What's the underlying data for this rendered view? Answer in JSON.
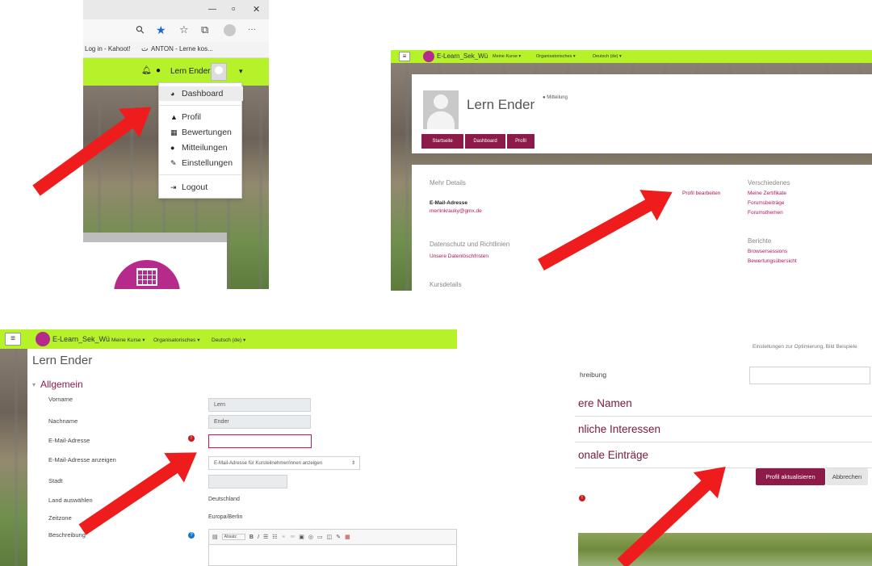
{
  "panel1": {
    "window_controls": {
      "minimize": "—",
      "maximize": "▫",
      "close": "✕"
    },
    "toolbar_icons": {
      "search": "⚲",
      "star": "★",
      "favorites": "☆",
      "collections": "⧉",
      "more": "···"
    },
    "bookmarks": {
      "kahoot": "Log in - Kahoot!",
      "anton": "ANTON - Lerne kos..."
    },
    "nav": {
      "user_name": "Lern Ender",
      "caret": "▾"
    },
    "menu": {
      "dashboard": "Dashboard",
      "profil": "Profil",
      "bewertungen": "Bewertungen",
      "mitteilungen": "Mitteilungen",
      "einstellungen": "Einstellungen",
      "logout": "Logout"
    }
  },
  "panel2": {
    "brand": "E-Learn_Sek_Wü",
    "nav": {
      "kurse": "Meine Kurse ▾",
      "orga": "Organisatorisches ▾",
      "lang": "Deutsch (de) ▾"
    },
    "user_name": "Lern Ender",
    "message_link": "Mitteilung",
    "breadcrumbs": {
      "startseite": "Startseite",
      "dashboard": "Dashboard",
      "profil": "Profil"
    },
    "details": {
      "heading": "Mehr Details",
      "edit_link": "Profil bearbeiten",
      "email_label": "E-Mail-Adresse",
      "email_value": "merlinkrauky@gmx.de",
      "privacy_heading": "Datenschutz und Richtlinien",
      "privacy_link": "Unsere Datenlöschfristen",
      "course_heading": "Kursdetails"
    },
    "misc": {
      "heading": "Verschiedenes",
      "certificates": "Meine Zertifikate",
      "forum_posts": "Forumsbeiträge",
      "forum_topics": "Forumsthemen"
    },
    "reports": {
      "heading": "Berichte",
      "sessions": "Browsersessions",
      "grades": "Bewertungsübersicht"
    }
  },
  "panel3": {
    "brand": "E-Learn_Sek_Wü",
    "nav": {
      "kurse": "Meine Kurse ▾",
      "orga": "Organisatorisches ▾",
      "lang": "Deutsch (de) ▾"
    },
    "page_title": "Lern Ender",
    "section": "Allgemein",
    "labels": {
      "vorname": "Vorname",
      "nachname": "Nachname",
      "email": "E-Mail-Adresse",
      "email_show": "E-Mail-Adresse anzeigen",
      "stadt": "Stadt",
      "land": "Land auswählen",
      "zeitzone": "Zeitzone",
      "beschreibung": "Beschreibung"
    },
    "values": {
      "vorname": "Lern",
      "nachname": "Ender",
      "email": "",
      "email_show": "E-Mail-Adresse für Kursteilnehmer/innen anzeigen",
      "stadt": "",
      "land": "Deutschland",
      "zeitzone": "Europa/Berlin"
    },
    "editor": {
      "format": "Absatz",
      "bold": "B",
      "italic": "I"
    }
  },
  "panel4": {
    "top_text": "Einstellungen zur Optimierung, Bild Beispiele",
    "beschreibung_label": "hreibung",
    "sections": {
      "namen": "ere Namen",
      "interessen": "nliche Interessen",
      "eintraege": "onale Einträge"
    },
    "buttons": {
      "update": "Profil aktualisieren",
      "cancel": "Abbrechen"
    }
  }
}
